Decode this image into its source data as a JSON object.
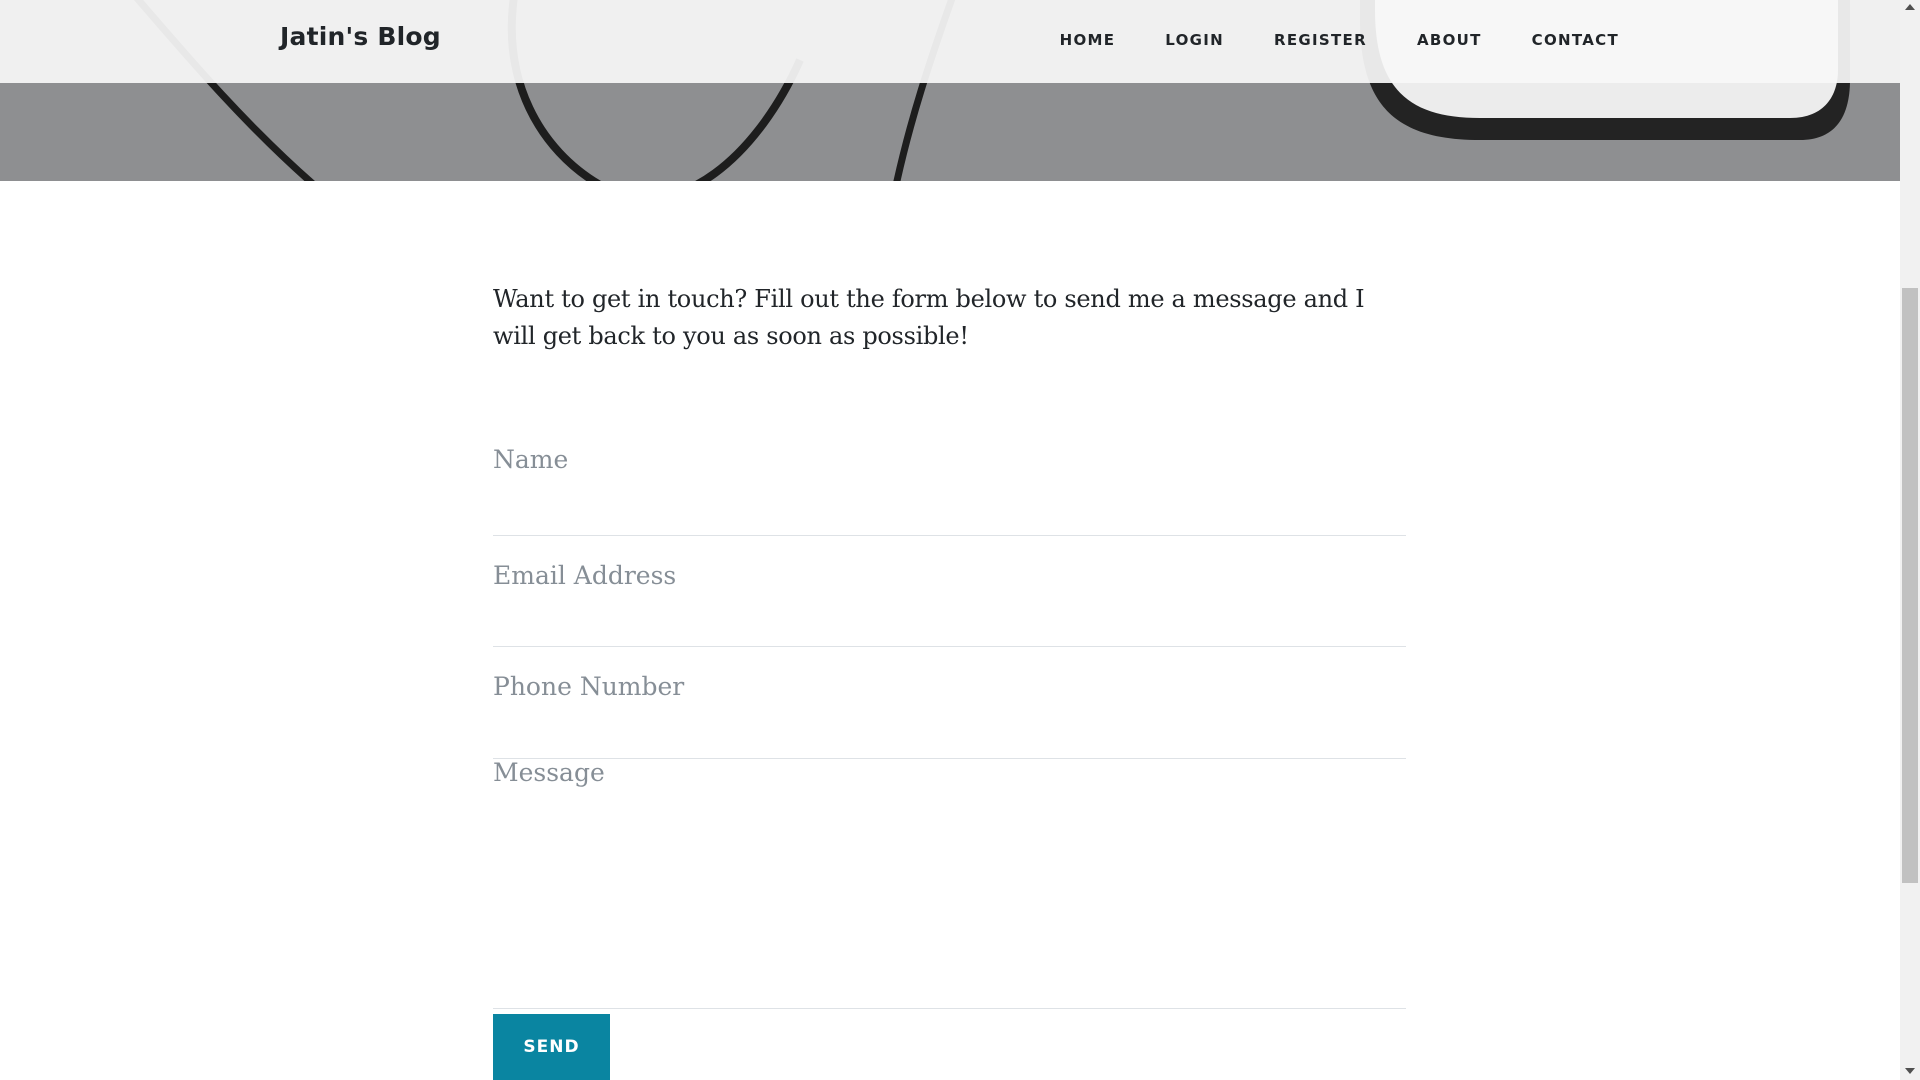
{
  "navbar": {
    "brand": "Jatin's Blog",
    "links": [
      {
        "label": "HOME"
      },
      {
        "label": "LOGIN"
      },
      {
        "label": "REGISTER"
      },
      {
        "label": "ABOUT"
      },
      {
        "label": "CONTACT"
      }
    ]
  },
  "contact": {
    "intro": "Want to get in touch? Fill out the form below to send me a message and I will get back to you as soon as possible!",
    "fields": {
      "name": {
        "placeholder": "Name",
        "value": ""
      },
      "email": {
        "placeholder": "Email Address",
        "value": ""
      },
      "phone": {
        "placeholder": "Phone Number",
        "value": ""
      },
      "message": {
        "placeholder": "Message",
        "value": ""
      }
    },
    "send_label": "SEND"
  },
  "colors": {
    "accent": "#0a85a1",
    "hero_overlay": "#8e8f91",
    "text": "#212529",
    "placeholder": "#868e96"
  },
  "icons": {
    "scroll_up": "triangle-up-icon",
    "scroll_down": "triangle-down-icon"
  }
}
